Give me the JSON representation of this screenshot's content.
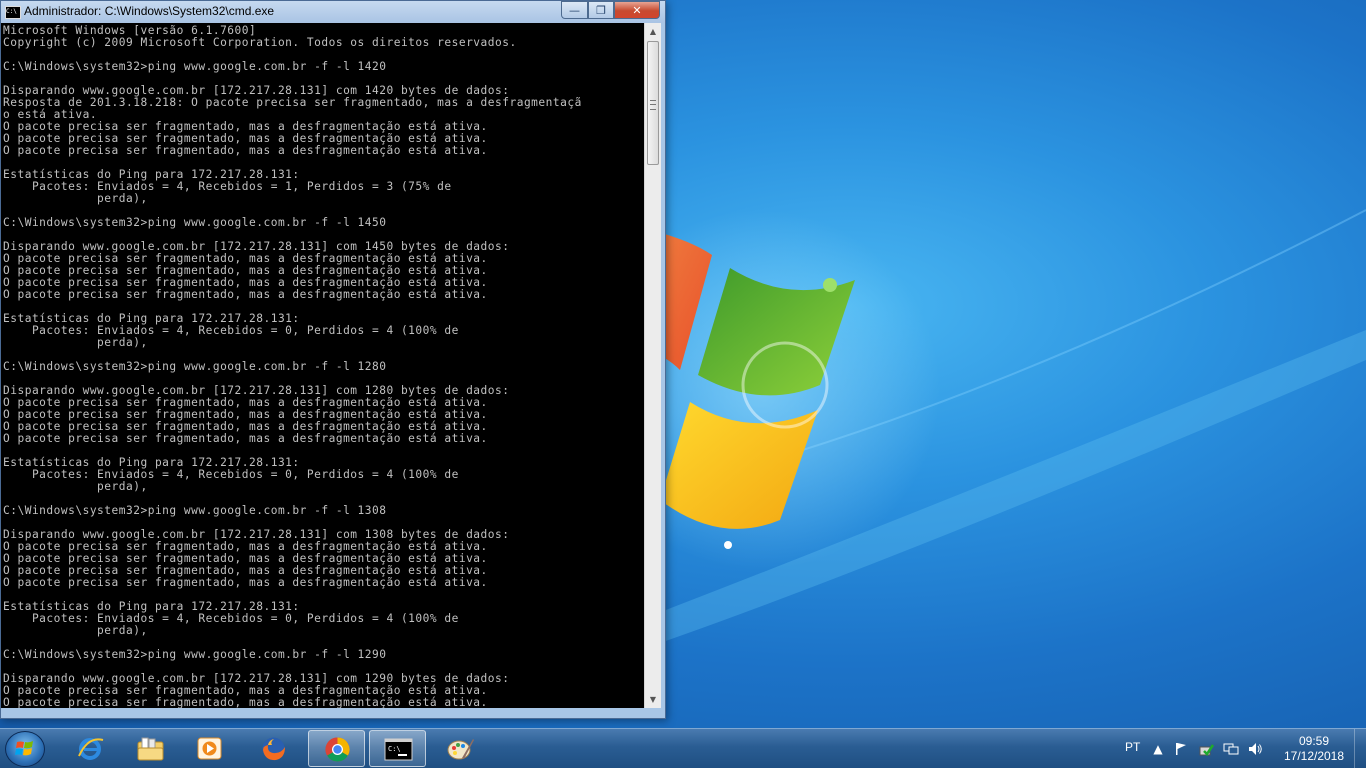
{
  "window": {
    "title": "Administrador: C:\\Windows\\System32\\cmd.exe",
    "minimize_glyph": "—",
    "maximize_glyph": "❐",
    "close_glyph": "✕",
    "icon_text": "C:\\"
  },
  "console": {
    "lines": [
      "Microsoft Windows [versão 6.1.7600]",
      "Copyright (c) 2009 Microsoft Corporation. Todos os direitos reservados.",
      "",
      "C:\\Windows\\system32>ping www.google.com.br -f -l 1420",
      "",
      "Disparando www.google.com.br [172.217.28.131] com 1420 bytes de dados:",
      "Resposta de 201.3.18.218: O pacote precisa ser fragmentado, mas a desfragmentaçã",
      "o está ativa.",
      "O pacote precisa ser fragmentado, mas a desfragmentação está ativa.",
      "O pacote precisa ser fragmentado, mas a desfragmentação está ativa.",
      "O pacote precisa ser fragmentado, mas a desfragmentação está ativa.",
      "",
      "Estatísticas do Ping para 172.217.28.131:",
      "    Pacotes: Enviados = 4, Recebidos = 1, Perdidos = 3 (75% de",
      "             perda),",
      "",
      "C:\\Windows\\system32>ping www.google.com.br -f -l 1450",
      "",
      "Disparando www.google.com.br [172.217.28.131] com 1450 bytes de dados:",
      "O pacote precisa ser fragmentado, mas a desfragmentação está ativa.",
      "O pacote precisa ser fragmentado, mas a desfragmentação está ativa.",
      "O pacote precisa ser fragmentado, mas a desfragmentação está ativa.",
      "O pacote precisa ser fragmentado, mas a desfragmentação está ativa.",
      "",
      "Estatísticas do Ping para 172.217.28.131:",
      "    Pacotes: Enviados = 4, Recebidos = 0, Perdidos = 4 (100% de",
      "             perda),",
      "",
      "C:\\Windows\\system32>ping www.google.com.br -f -l 1280",
      "",
      "Disparando www.google.com.br [172.217.28.131] com 1280 bytes de dados:",
      "O pacote precisa ser fragmentado, mas a desfragmentação está ativa.",
      "O pacote precisa ser fragmentado, mas a desfragmentação está ativa.",
      "O pacote precisa ser fragmentado, mas a desfragmentação está ativa.",
      "O pacote precisa ser fragmentado, mas a desfragmentação está ativa.",
      "",
      "Estatísticas do Ping para 172.217.28.131:",
      "    Pacotes: Enviados = 4, Recebidos = 0, Perdidos = 4 (100% de",
      "             perda),",
      "",
      "C:\\Windows\\system32>ping www.google.com.br -f -l 1308",
      "",
      "Disparando www.google.com.br [172.217.28.131] com 1308 bytes de dados:",
      "O pacote precisa ser fragmentado, mas a desfragmentação está ativa.",
      "O pacote precisa ser fragmentado, mas a desfragmentação está ativa.",
      "O pacote precisa ser fragmentado, mas a desfragmentação está ativa.",
      "O pacote precisa ser fragmentado, mas a desfragmentação está ativa.",
      "",
      "Estatísticas do Ping para 172.217.28.131:",
      "    Pacotes: Enviados = 4, Recebidos = 0, Perdidos = 4 (100% de",
      "             perda),",
      "",
      "C:\\Windows\\system32>ping www.google.com.br -f -l 1290",
      "",
      "Disparando www.google.com.br [172.217.28.131] com 1290 bytes de dados:",
      "O pacote precisa ser fragmentado, mas a desfragmentação está ativa.",
      "O pacote precisa ser fragmentado, mas a desfragmentação está ativa."
    ]
  },
  "scrollbar": {
    "up_glyph": "▲",
    "down_glyph": "▼"
  },
  "taskbar": {
    "apps": [
      {
        "name": "Internet Explorer",
        "icon": "internet-explorer-icon"
      },
      {
        "name": "Windows Explorer",
        "icon": "folder-library-icon"
      },
      {
        "name": "Windows Media Player",
        "icon": "media-player-icon"
      },
      {
        "name": "Firefox",
        "icon": "firefox-icon"
      },
      {
        "name": "Google Chrome",
        "icon": "chrome-icon"
      },
      {
        "name": "Prompt de Comando",
        "icon": "cmd-icon"
      },
      {
        "name": "Paint",
        "icon": "paint-icon"
      }
    ],
    "language": "PT",
    "tray_icons": [
      "show-hidden-icons-icon",
      "action-center-flag-icon",
      "sync-icon",
      "network-icon",
      "volume-icon"
    ],
    "time": "09:59",
    "date": "17/12/2018"
  },
  "colors": {
    "console_bg": "#000000",
    "console_text": "#c0c0c0",
    "taskbar": "#2a5d93",
    "desktop": "#2b93e0"
  }
}
